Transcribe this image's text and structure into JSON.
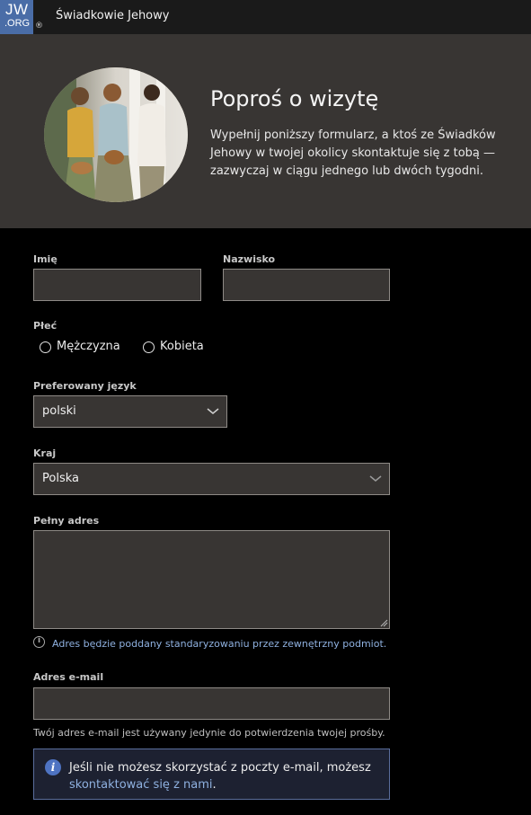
{
  "header": {
    "logo_line1": "JW",
    "logo_line2": ".ORG",
    "registered": "®",
    "site_name": "Świadkowie Jehowy"
  },
  "hero": {
    "title": "Poproś o wizytę",
    "description": "Wypełnij poniższy formularz, a ktoś ze Świadków Jehowy w twojej okolicy skontaktuje się z tobą — zazwyczaj w ciągu jednego lub dwóch tygodni."
  },
  "form": {
    "first_name": {
      "label": "Imię",
      "value": ""
    },
    "last_name": {
      "label": "Nazwisko",
      "value": ""
    },
    "gender": {
      "label": "Płeć",
      "options": [
        "Mężczyzna",
        "Kobieta"
      ]
    },
    "language": {
      "label": "Preferowany język",
      "value": "polski"
    },
    "country": {
      "label": "Kraj",
      "value": "Polska"
    },
    "address": {
      "label": "Pełny adres",
      "value": "",
      "hint": "Adres będzie poddany standaryzowaniu przez zewnętrzny podmiot."
    },
    "email": {
      "label": "Adres e-mail",
      "value": "",
      "note": "Twój adres e-mail jest używany jedynie do potwierdzenia twojej prośby."
    },
    "info": {
      "text": "Jeśli nie możesz skorzystać z poczty e-mail, możesz",
      "link": "skontaktować się z nami",
      "suffix": "."
    }
  },
  "colors": {
    "accent": "#4a6da7",
    "link": "#8fb1e0",
    "hero_bg": "#383533",
    "field_bg": "#383533"
  }
}
